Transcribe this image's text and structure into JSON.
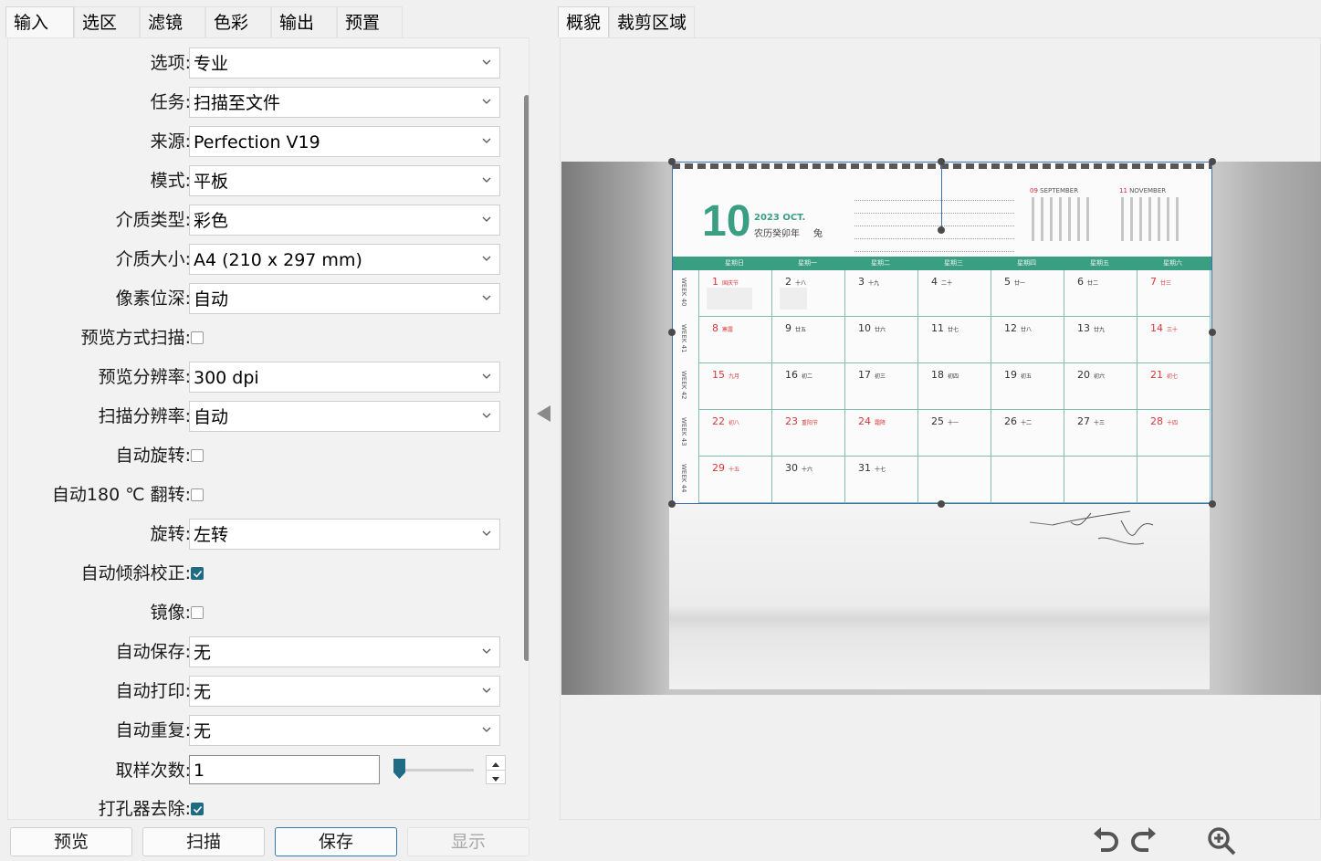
{
  "left_tabs": [
    {
      "label": "输入",
      "active": true
    },
    {
      "label": "选区",
      "active": false
    },
    {
      "label": "滤镜",
      "active": false
    },
    {
      "label": "色彩",
      "active": false
    },
    {
      "label": "输出",
      "active": false
    },
    {
      "label": "预置",
      "active": false
    }
  ],
  "right_tabs": [
    {
      "label": "概貌",
      "active": true
    },
    {
      "label": "裁剪区域",
      "active": false
    }
  ],
  "form": {
    "option": {
      "label": "选项:",
      "value": "专业"
    },
    "task": {
      "label": "任务:",
      "value": "扫描至文件"
    },
    "source": {
      "label": "来源:",
      "value": "Perfection V19"
    },
    "mode": {
      "label": "模式:",
      "value": "平板"
    },
    "media_type": {
      "label": "介质类型:",
      "value": "彩色"
    },
    "media_size": {
      "label": "介质大小:",
      "value": "A4 (210 x 297 mm)"
    },
    "bit_depth": {
      "label": "像素位深:",
      "value": "自动"
    },
    "preview_scan": {
      "label": "预览方式扫描:",
      "checked": false
    },
    "preview_res": {
      "label": "预览分辨率:",
      "value": "300 dpi"
    },
    "scan_res": {
      "label": "扫描分辨率:",
      "value": "自动"
    },
    "auto_rotate": {
      "label": "自动旋转:",
      "checked": false
    },
    "auto_flip": {
      "label": "自动180 ℃ 翻转:",
      "checked": false
    },
    "rotate": {
      "label": "旋转:",
      "value": "左转"
    },
    "auto_deskew": {
      "label": "自动倾斜校正:",
      "checked": true
    },
    "mirror": {
      "label": "镜像:",
      "checked": false
    },
    "auto_save": {
      "label": "自动保存:",
      "value": "无"
    },
    "auto_print": {
      "label": "自动打印:",
      "value": "无"
    },
    "auto_repeat": {
      "label": "自动重复:",
      "value": "无"
    },
    "samples": {
      "label": "取样次数:",
      "value": "1"
    },
    "punch_remove": {
      "label": "打孔器去除:",
      "checked": true
    }
  },
  "buttons": {
    "preview": "预览",
    "scan": "扫描",
    "save": "保存",
    "show": "显示"
  },
  "calendar": {
    "month_number": "10",
    "month_en": "2023 OCT.",
    "lunar_year": "农历癸卯年",
    "zodiac": "兔",
    "mini_left": {
      "num": "09",
      "name": "SEPTEMBER"
    },
    "mini_right": {
      "num": "11",
      "name": "NOVEMBER"
    },
    "weekdays": [
      "星期日",
      "星期一",
      "星期二",
      "星期三",
      "星期四",
      "星期五",
      "星期六"
    ],
    "weeks": [
      "WEEK 40",
      "WEEK 41",
      "WEEK 42",
      "WEEK 43",
      "WEEK 44"
    ],
    "days": [
      [
        {
          "d": "1",
          "l": "国庆节",
          "red": true
        },
        {
          "d": "2",
          "l": "十八"
        },
        {
          "d": "3",
          "l": "十九"
        },
        {
          "d": "4",
          "l": "二十"
        },
        {
          "d": "5",
          "l": "廿一"
        },
        {
          "d": "6",
          "l": "廿二"
        },
        {
          "d": "7",
          "l": "廿三",
          "red": true
        }
      ],
      [
        {
          "d": "8",
          "l": "寒露",
          "red": true
        },
        {
          "d": "9",
          "l": "廿五"
        },
        {
          "d": "10",
          "l": "廿六"
        },
        {
          "d": "11",
          "l": "廿七"
        },
        {
          "d": "12",
          "l": "廿八"
        },
        {
          "d": "13",
          "l": "廿九"
        },
        {
          "d": "14",
          "l": "三十",
          "red": true
        }
      ],
      [
        {
          "d": "15",
          "l": "九月",
          "red": true
        },
        {
          "d": "16",
          "l": "初二"
        },
        {
          "d": "17",
          "l": "初三"
        },
        {
          "d": "18",
          "l": "初四"
        },
        {
          "d": "19",
          "l": "初五"
        },
        {
          "d": "20",
          "l": "初六"
        },
        {
          "d": "21",
          "l": "初七",
          "red": true
        }
      ],
      [
        {
          "d": "22",
          "l": "初八",
          "red": true
        },
        {
          "d": "23",
          "l": "重阳节",
          "red": true
        },
        {
          "d": "24",
          "l": "霜降",
          "red": true
        },
        {
          "d": "25",
          "l": "十一"
        },
        {
          "d": "26",
          "l": "十二"
        },
        {
          "d": "27",
          "l": "十三"
        },
        {
          "d": "28",
          "l": "十四",
          "red": true
        }
      ],
      [
        {
          "d": "29",
          "l": "十五",
          "red": true
        },
        {
          "d": "30",
          "l": "十六"
        },
        {
          "d": "31",
          "l": "十七"
        },
        {
          "d": ""
        },
        {
          "d": ""
        },
        {
          "d": ""
        },
        {
          "d": ""
        }
      ]
    ]
  },
  "icons": {
    "collapse": "triangle-left-icon",
    "undo": "rotate-left-icon",
    "redo": "rotate-right-icon",
    "zoom": "zoom-in-icon"
  },
  "colors": {
    "accent": "#1f6b85",
    "calendar_green": "#3a9e82",
    "selection": "#3f6fb0"
  }
}
